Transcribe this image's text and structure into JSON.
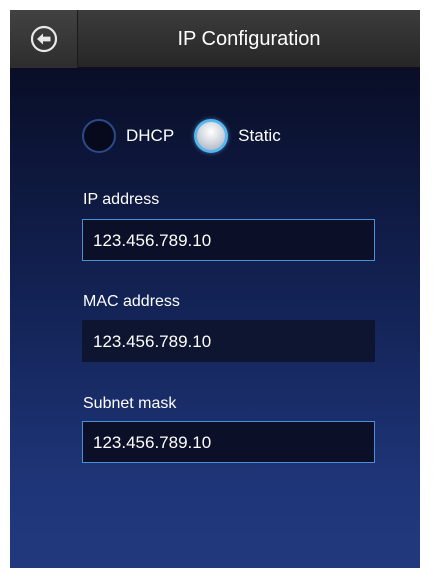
{
  "header": {
    "title": "IP Configuration"
  },
  "mode": {
    "options": [
      {
        "label": "DHCP",
        "selected": false
      },
      {
        "label": "Static",
        "selected": true
      }
    ]
  },
  "fields": {
    "ip_address": {
      "label": "IP address",
      "value": "123.456.789.10"
    },
    "mac_address": {
      "label": "MAC address",
      "value": "123.456.789.10"
    },
    "subnet_mask": {
      "label": "Subnet mask",
      "value": "123.456.789.10"
    }
  },
  "colors": {
    "accent": "#58b6ee",
    "field_border": "#4b8fd6"
  }
}
